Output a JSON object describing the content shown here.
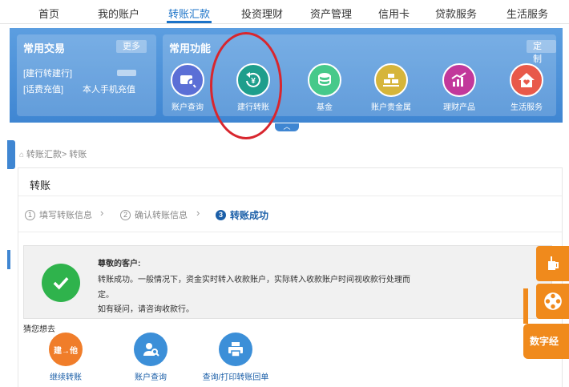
{
  "nav": {
    "items": [
      "首页",
      "我的账户",
      "转账汇款",
      "投资理财",
      "资产管理",
      "信用卡",
      "贷款服务",
      "生活服务"
    ],
    "active_index": 2
  },
  "quick": {
    "title": "常用交易",
    "more_label": "更多",
    "links": [
      {
        "label": "[建行转建行]",
        "value": ""
      },
      {
        "label": "[话费充值]",
        "value": "本人手机充值"
      }
    ]
  },
  "functions": {
    "title": "常用功能",
    "customize_label": "定制",
    "items": [
      {
        "label": "账户查询",
        "icon": "account-query-icon",
        "color": "#5b6fd6"
      },
      {
        "label": "建行转账",
        "icon": "yen-transfer-icon",
        "color": "#1e9e8c"
      },
      {
        "label": "基金",
        "icon": "coins-icon",
        "color": "#46c98a"
      },
      {
        "label": "账户贵金属",
        "icon": "gold-bars-icon",
        "color": "#d6b53a"
      },
      {
        "label": "理财产品",
        "icon": "chart-bag-icon",
        "color": "#c2389b"
      },
      {
        "label": "生活服务",
        "icon": "house-heart-icon",
        "color": "#e8594a"
      }
    ]
  },
  "breadcrumb": "转账汇款> 转账",
  "card": {
    "title": "转账",
    "steps": [
      {
        "num": "1",
        "label": "填写转账信息"
      },
      {
        "num": "2",
        "label": "确认转账信息"
      },
      {
        "num": "3",
        "label": "转账成功"
      }
    ],
    "active_step": 3,
    "message": {
      "greeting": "尊敬的客户:",
      "line1": "转账成功。一般情况下，资金实时转入收款账户，实际转入收款账户时间视收款行处理而",
      "line2": "定。",
      "line3": "如有疑问，请咨询收款行。"
    },
    "guess_label": "猜您想去",
    "recommendations": [
      {
        "label": "继续转账",
        "icon": "continue-transfer-icon",
        "badge": "建→他",
        "color": "#f07d2a"
      },
      {
        "label": "账户查询",
        "icon": "user-search-icon",
        "color": "#3c8fd8"
      },
      {
        "label": "查询/打印转账回单",
        "icon": "printer-icon",
        "color": "#3c8fd8"
      }
    ]
  },
  "side": {
    "digital_label": "数字经"
  },
  "colors": {
    "brand_blue": "#3f86d2",
    "success_green": "#2fb34c",
    "annotation_red": "#d8262e",
    "accent_orange": "#f08a1c"
  }
}
